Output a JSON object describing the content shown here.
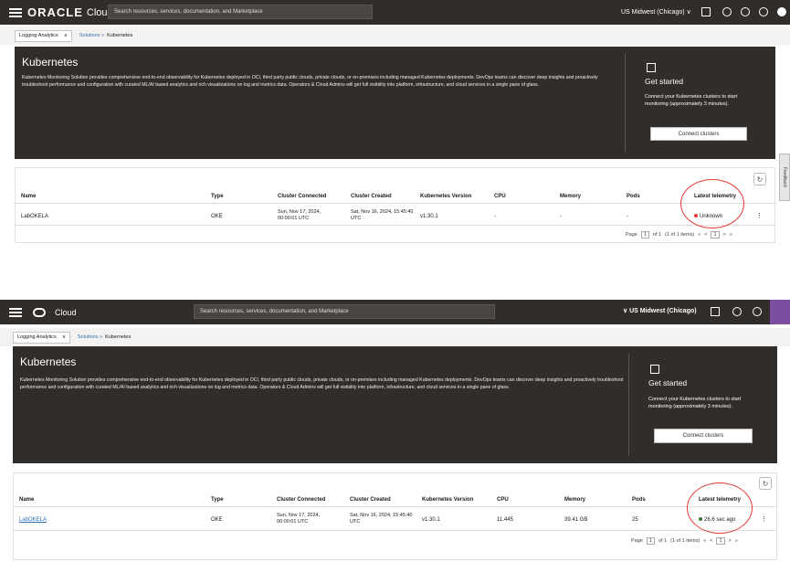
{
  "shot1": {
    "header": {
      "brand": "ORACLE",
      "brand_suffix": "Cloud",
      "search_placeholder": "Search resources, services, documentation, and Marketplace",
      "region": "US Midwest (Chicago) ∨"
    },
    "breadcrumb": {
      "select": "Logging Analytics",
      "link": "Solutions »",
      "current": "Kubernetes"
    },
    "banner": {
      "title": "Kubernetes",
      "description": "Kubernetes Monitoring Solution provides comprehensive end-to-end observability for Kubernetes deployed in OCI, third party public clouds, private clouds, or on-premises including managed Kubernetes deployments. DevOps teams can discover deep insights and proactively troubleshoot performance and configuration with curated ML/AI based analytics and rich visualizations on log and metrics data. Operators & Cloud Admins will get full visibility into platform, infrastructure, and cloud services in a single pane of glass.",
      "get_started_title": "Get started",
      "get_started_text": "Connect your Kubernetes clusters to start monitoring (approximately 3 minutes).",
      "connect_button": "Connect clusters"
    },
    "side_tab": "Feedback",
    "table": {
      "headers": [
        "Name",
        "Type",
        "Cluster Connected",
        "Cluster Created",
        "Kubernetes Version",
        "CPU",
        "Memory",
        "Pods",
        "Latest telemetry"
      ],
      "row": {
        "name": "LabOKELA",
        "type": "OKE",
        "connected": "Sun, Nov 17, 2024, 00:00:01 UTC",
        "created": "Sat, Nov 16, 2024, 15:45:40 UTC",
        "version": "v1.30.1",
        "cpu": "-",
        "memory": "-",
        "pods": "-",
        "telemetry": "Unknown",
        "telemetry_color": "#e53935"
      },
      "pager": {
        "label": "Page",
        "page": "1",
        "of": "of 1",
        "items": "(1 of 1 items)",
        "first": "«",
        "prev": "<",
        "current": "1",
        "next": ">",
        "last": "»"
      }
    }
  },
  "shot2": {
    "header": {
      "brand": "Cloud",
      "search_placeholder": "Search resources, services, documentation, and Marketplace",
      "region": "∨  US Midwest (Chicago)"
    },
    "breadcrumb": {
      "select": "Logging Analytics",
      "link": "Solutions »",
      "current": "Kubernetes"
    },
    "banner": {
      "title": "Kubernetes",
      "description": "Kubernetes Monitoring Solution provides comprehensive end-to-end observability for Kubernetes deployed in OCI, third party public clouds, private clouds, or on-premises including managed Kubernetes deployments. DevOps teams can discover deep insights and proactively troubleshoot performance and configuration with curated ML/AI based analytics and rich visualizations on log and metrics data. Operators & Cloud Admins will get full visibility into platform, infrastructure, and cloud services in a single pane of glass.",
      "get_started_title": "Get started",
      "get_started_text": "Connect your Kubernetes clusters to start monitoring (approximately 3 minutes).",
      "connect_button": "Connect clusters"
    },
    "table": {
      "headers": [
        "Name",
        "Type",
        "Cluster Connected",
        "Cluster Created",
        "Kubernetes Version",
        "CPU",
        "Memory",
        "Pods",
        "Latest telemetry"
      ],
      "row": {
        "name": "LabOKELA",
        "type": "OKE",
        "connected": "Sun, Nov 17, 2024, 00:00:01 UTC",
        "created": "Sat, Nov 16, 2024, 15:45:40 UTC",
        "version": "v1.30.1",
        "cpu": "11.445",
        "memory": "39.41 GB",
        "pods": "25",
        "telemetry": "26.6 sec ago",
        "telemetry_color": "#2e7d32"
      },
      "pager": {
        "label": "Page",
        "page": "1",
        "of": "of 1",
        "items": "(1 of 1 items)",
        "first": "«",
        "prev": "<",
        "current": "1",
        "next": ">",
        "last": "»"
      }
    }
  },
  "colors": {
    "header_bg": "#312d2a",
    "banner_bg": "#312d2a",
    "annotation": "#e53935",
    "link": "#2a6db0"
  }
}
